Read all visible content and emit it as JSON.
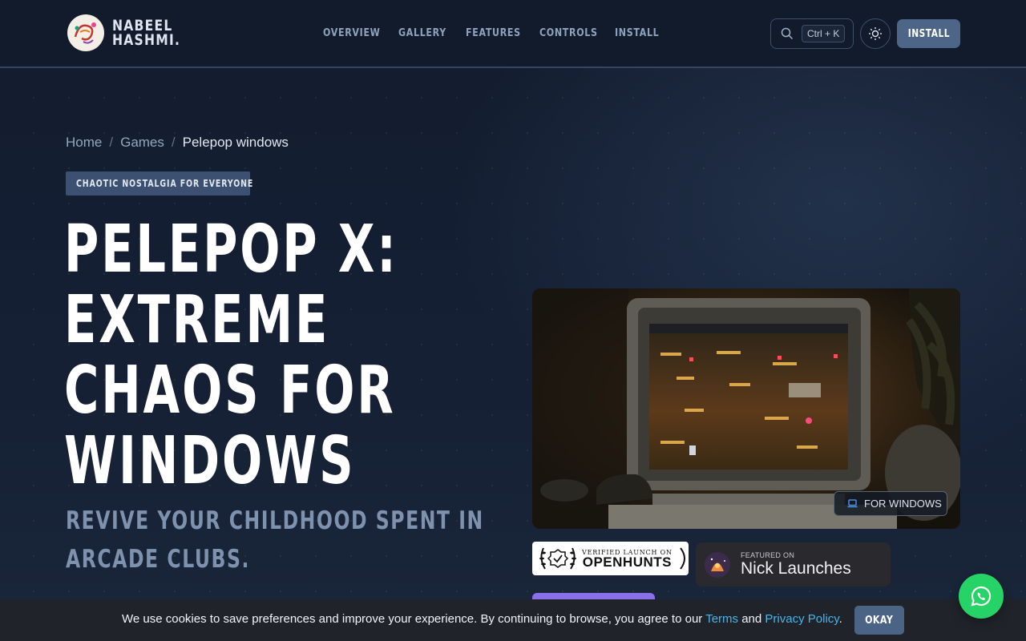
{
  "header": {
    "logo_line1": "NABEEL",
    "logo_line2": "HASHMI.",
    "nav": [
      "OVERVIEW",
      "GALLERY",
      "FEATURES",
      "CONTROLS",
      "INSTALL"
    ],
    "search_shortcut": "Ctrl + K",
    "install_label": "INSTALL"
  },
  "breadcrumb": {
    "items": [
      "Home",
      "Games",
      "Pelepop windows"
    ],
    "separator": "/"
  },
  "hero": {
    "tag": "CHAOTIC NOSTALGIA FOR EVERYONE",
    "title_lines": [
      "PELEPOP X:",
      "EXTREME",
      "CHAOS FOR",
      "WINDOWS"
    ],
    "subtitle_lines": [
      "REVIVE YOUR CHILDHOOD SPENT IN",
      "ARCADE CLUBS."
    ],
    "image_badge": "FOR WINDOWS"
  },
  "badges": {
    "openhunts_small": "VERIFIED LAUNCH ON",
    "openhunts_main": "OPENHUNTS",
    "nick_small": "FEATURED ON",
    "nick_main": "Nick Launches"
  },
  "cookie": {
    "text_before": "We use cookies to save preferences and improve your experience. By continuing to browse, you agree to our ",
    "terms": "Terms",
    "and": " and ",
    "privacy": "Privacy Policy",
    "period": ".",
    "button": "OKAY"
  },
  "icons": {
    "search": "search-icon",
    "theme": "sun-icon",
    "whatsapp": "whatsapp-icon",
    "laptop": "laptop-icon"
  },
  "colors": {
    "background": "#131c2e",
    "accent": "#4d6586",
    "link": "#43b6ee",
    "whatsapp": "#25d366"
  }
}
